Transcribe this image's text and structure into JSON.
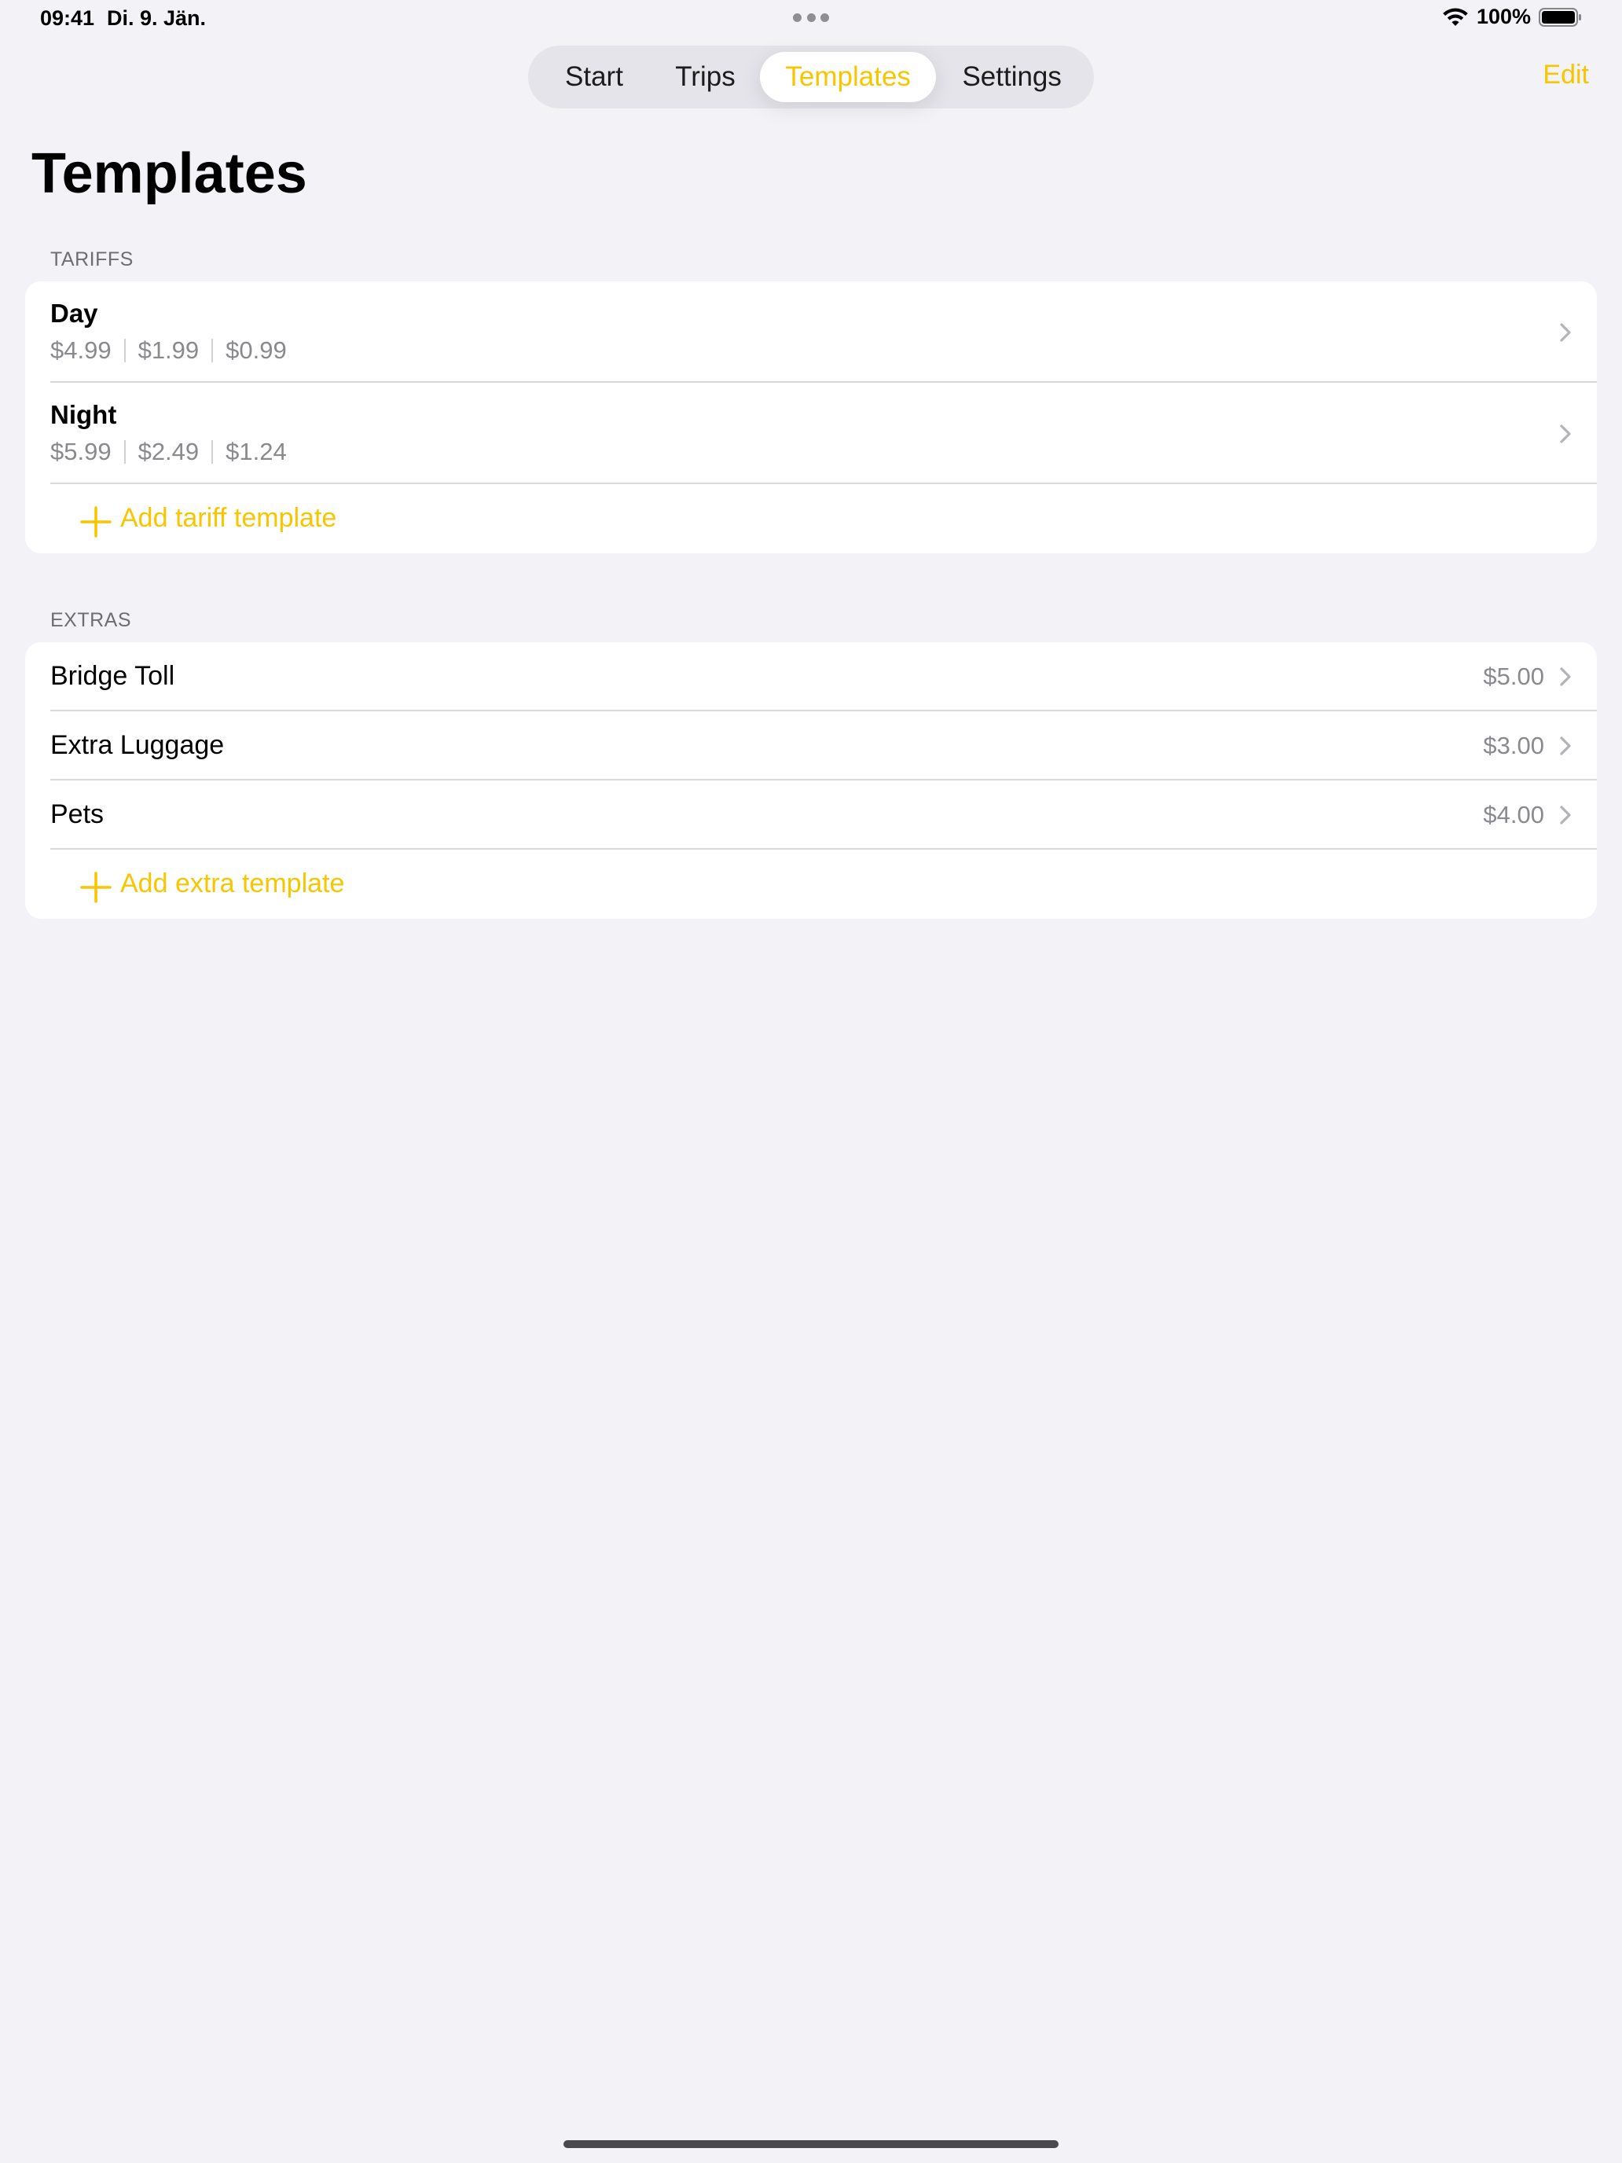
{
  "status_bar": {
    "time": "09:41",
    "date": "Di. 9. Jän.",
    "battery_percent": "100%"
  },
  "segments": {
    "start": "Start",
    "trips": "Trips",
    "templates": "Templates",
    "settings": "Settings",
    "selected": "Templates"
  },
  "nav": {
    "edit_label": "Edit"
  },
  "page_title": "Templates",
  "tariffs": {
    "header": "TARIFFS",
    "items": [
      {
        "name": "Day",
        "prices": [
          "$4.99",
          "$1.99",
          "$0.99"
        ]
      },
      {
        "name": "Night",
        "prices": [
          "$5.99",
          "$2.49",
          "$1.24"
        ]
      }
    ],
    "add_label": "Add tariff template"
  },
  "extras": {
    "header": "EXTRAS",
    "items": [
      {
        "name": "Bridge Toll",
        "price": "$5.00"
      },
      {
        "name": "Extra Luggage",
        "price": "$3.00"
      },
      {
        "name": "Pets",
        "price": "$4.00"
      }
    ],
    "add_label": "Add extra template"
  },
  "colors": {
    "accent": "#f7c600",
    "background": "#f2f2f7",
    "secondary_text": "#8a8a8e"
  }
}
